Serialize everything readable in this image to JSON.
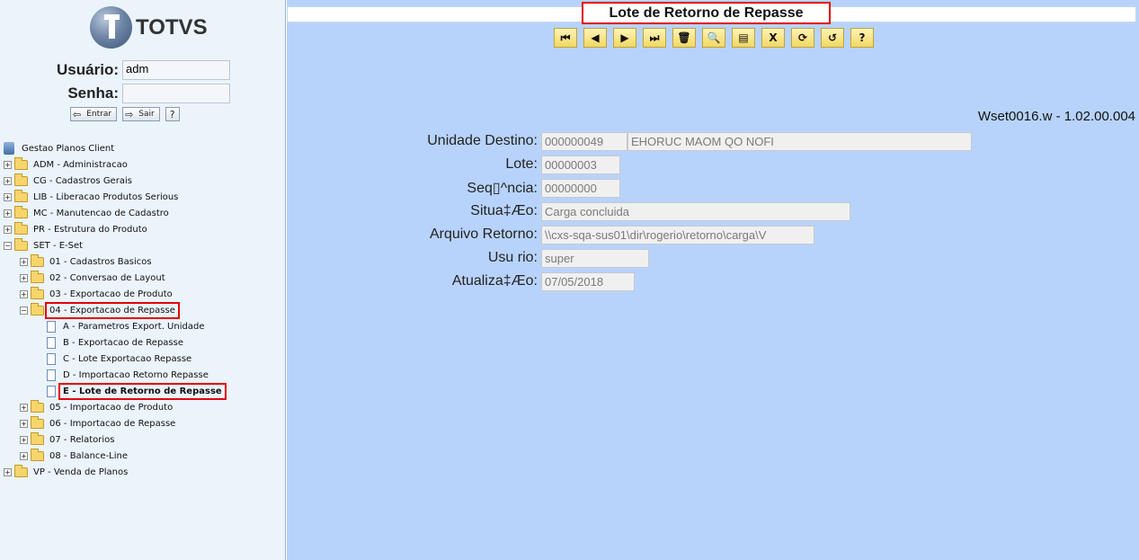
{
  "left_panel": {
    "logo_text": "TOTVS",
    "user_label": "Usuário:",
    "user_value": "adm",
    "password_label": "Senha:",
    "password_value": "",
    "enter_label": "Entrar",
    "exit_label": "Sair",
    "help_label": "?",
    "tree": {
      "root": "Gestao Planos Client",
      "items": [
        "ADM - Administracao",
        "CG - Cadastros Gerais",
        "LIB - Liberacao Produtos Serious",
        "MC - Manutencao de Cadastro",
        "PR - Estrutura do Produto",
        "SET - E-Set",
        "01 - Cadastros Basicos",
        "02 - Conversao de Layout",
        "03 - Exportacao de Produto",
        "04 - Exportacao de Repasse",
        "A - Parametros Export. Unidade",
        "B - Exportacao de Repasse",
        "C - Lote Exportacao Repasse",
        "D - Importacao Retorno Repasse",
        "E - Lote de Retorno de Repasse",
        "05 - Importacao de Produto",
        "06 - Importacao de Repasse",
        "07 - Relatorios",
        "08 - Balance-Line",
        "VP - Venda de Planos"
      ]
    }
  },
  "main": {
    "title": "Lote de Retorno de Repasse",
    "toolbar": {
      "icons": [
        "first-icon",
        "previous-icon",
        "next-icon",
        "last-icon",
        "delete-icon",
        "search-icon",
        "report-icon",
        "close-icon",
        "refresh-icon",
        "undo-icon",
        "help-icon"
      ],
      "glyphs": [
        "⏮",
        "◀",
        "▶",
        "⏭",
        "🗑",
        "🔍",
        "▤",
        "X",
        "⟳",
        "↺",
        "?"
      ]
    },
    "version": "Wset0016.w - 1.02.00.004",
    "fields": {
      "unidade_destino_label": "Unidade Destino:",
      "unidade_destino_code": "000000049",
      "unidade_destino_name": "EHORUC MAOM QO NOFI",
      "lote_label": "Lote:",
      "lote_value": "00000003",
      "sequencia_label": "Seq▯^ncia:",
      "sequencia_value": "00000000",
      "situacao_label": "Situa‡Æo:",
      "situacao_value": "Carga concluida",
      "arquivo_label": "Arquivo Retorno:",
      "arquivo_value": "\\\\cxs-sqa-sus01\\dir\\rogerio\\retorno\\carga\\V",
      "usuario_label": "Usu rio:",
      "usuario_value": "super",
      "atualizacao_label": "Atualiza‡Æo:",
      "atualizacao_value": "07/05/2018"
    }
  },
  "colors": {
    "right_bg": "#b8d3fb",
    "left_bg": "#ebf3fb",
    "highlight": "#e30000",
    "toolbar_btn": "#f2d860"
  }
}
